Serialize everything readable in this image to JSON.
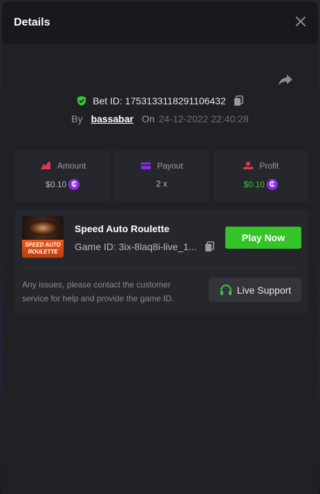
{
  "header": {
    "title": "Details"
  },
  "bet": {
    "id_text": "Bet ID: 1753133118291106432",
    "by_label": "By",
    "username": "bassabar",
    "on_label": "On",
    "datetime": "24-12-2022 22:40:28"
  },
  "stats": [
    {
      "label": "Amount",
      "value": "$0.10",
      "icon": "amount-icon",
      "color": "#e0375a"
    },
    {
      "label": "Payout",
      "value": "2 x",
      "icon": "card-icon",
      "color": "#8a2be2"
    },
    {
      "label": "Profit",
      "value": "$0.10",
      "icon": "profit-hand-icon",
      "color": "#e0375a",
      "value_color": "#35c93a"
    }
  ],
  "currency_symbol": "₵",
  "game": {
    "thumb_text": "SPEED AUTO ROULETTE",
    "title": "Speed Auto Roulette",
    "id_text": "Game ID: 3ix-8laq8i-live_1...",
    "play_label": "Play Now",
    "notice": "Any issues, please contact the customer service for help and provide the game ID.",
    "support_label": "Live Support"
  },
  "colors": {
    "accent_green": "#35c32a",
    "profit_green": "#35c93a",
    "coin_purple": "#8a2be2"
  }
}
